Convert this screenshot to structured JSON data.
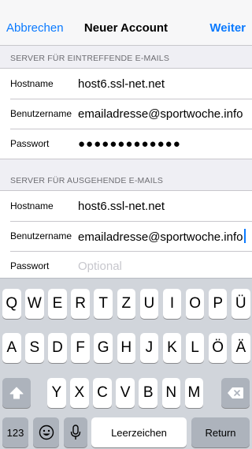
{
  "navbar": {
    "cancel_label": "Abbrechen",
    "title": "Neuer Account",
    "next_label": "Weiter"
  },
  "incoming": {
    "header": "SERVER FÜR EINTREFFENDE E-MAILS",
    "hostname_label": "Hostname",
    "hostname_value": "host6.ssl-net.net",
    "username_label": "Benutzername",
    "username_value": "emailadresse@sportwoche.info",
    "password_label": "Passwort",
    "password_value": "●●●●●●●●●●●●●"
  },
  "outgoing": {
    "header": "SERVER FÜR AUSGEHENDE E-MAILS",
    "hostname_label": "Hostname",
    "hostname_value": "host6.ssl-net.net",
    "username_label": "Benutzername",
    "username_value": "emailadresse@sportwoche.info",
    "password_label": "Passwort",
    "password_placeholder": "Optional"
  },
  "keyboard": {
    "row1": [
      "Q",
      "W",
      "E",
      "R",
      "T",
      "Z",
      "U",
      "I",
      "O",
      "P",
      "Ü"
    ],
    "row2": [
      "A",
      "S",
      "D",
      "F",
      "G",
      "H",
      "J",
      "K",
      "L",
      "Ö",
      "Ä"
    ],
    "row3": [
      "Y",
      "X",
      "C",
      "V",
      "B",
      "N",
      "M"
    ],
    "numbers_label": "123",
    "space_label": "Leerzeichen",
    "return_label": "Return",
    "icons": {
      "shift": "shift-icon",
      "delete": "backspace-icon",
      "emoji": "emoji-icon",
      "mic": "microphone-icon"
    }
  },
  "colors": {
    "accent": "#0a7aff",
    "background": "#efeff4",
    "keyboard": "#d1d5db"
  }
}
